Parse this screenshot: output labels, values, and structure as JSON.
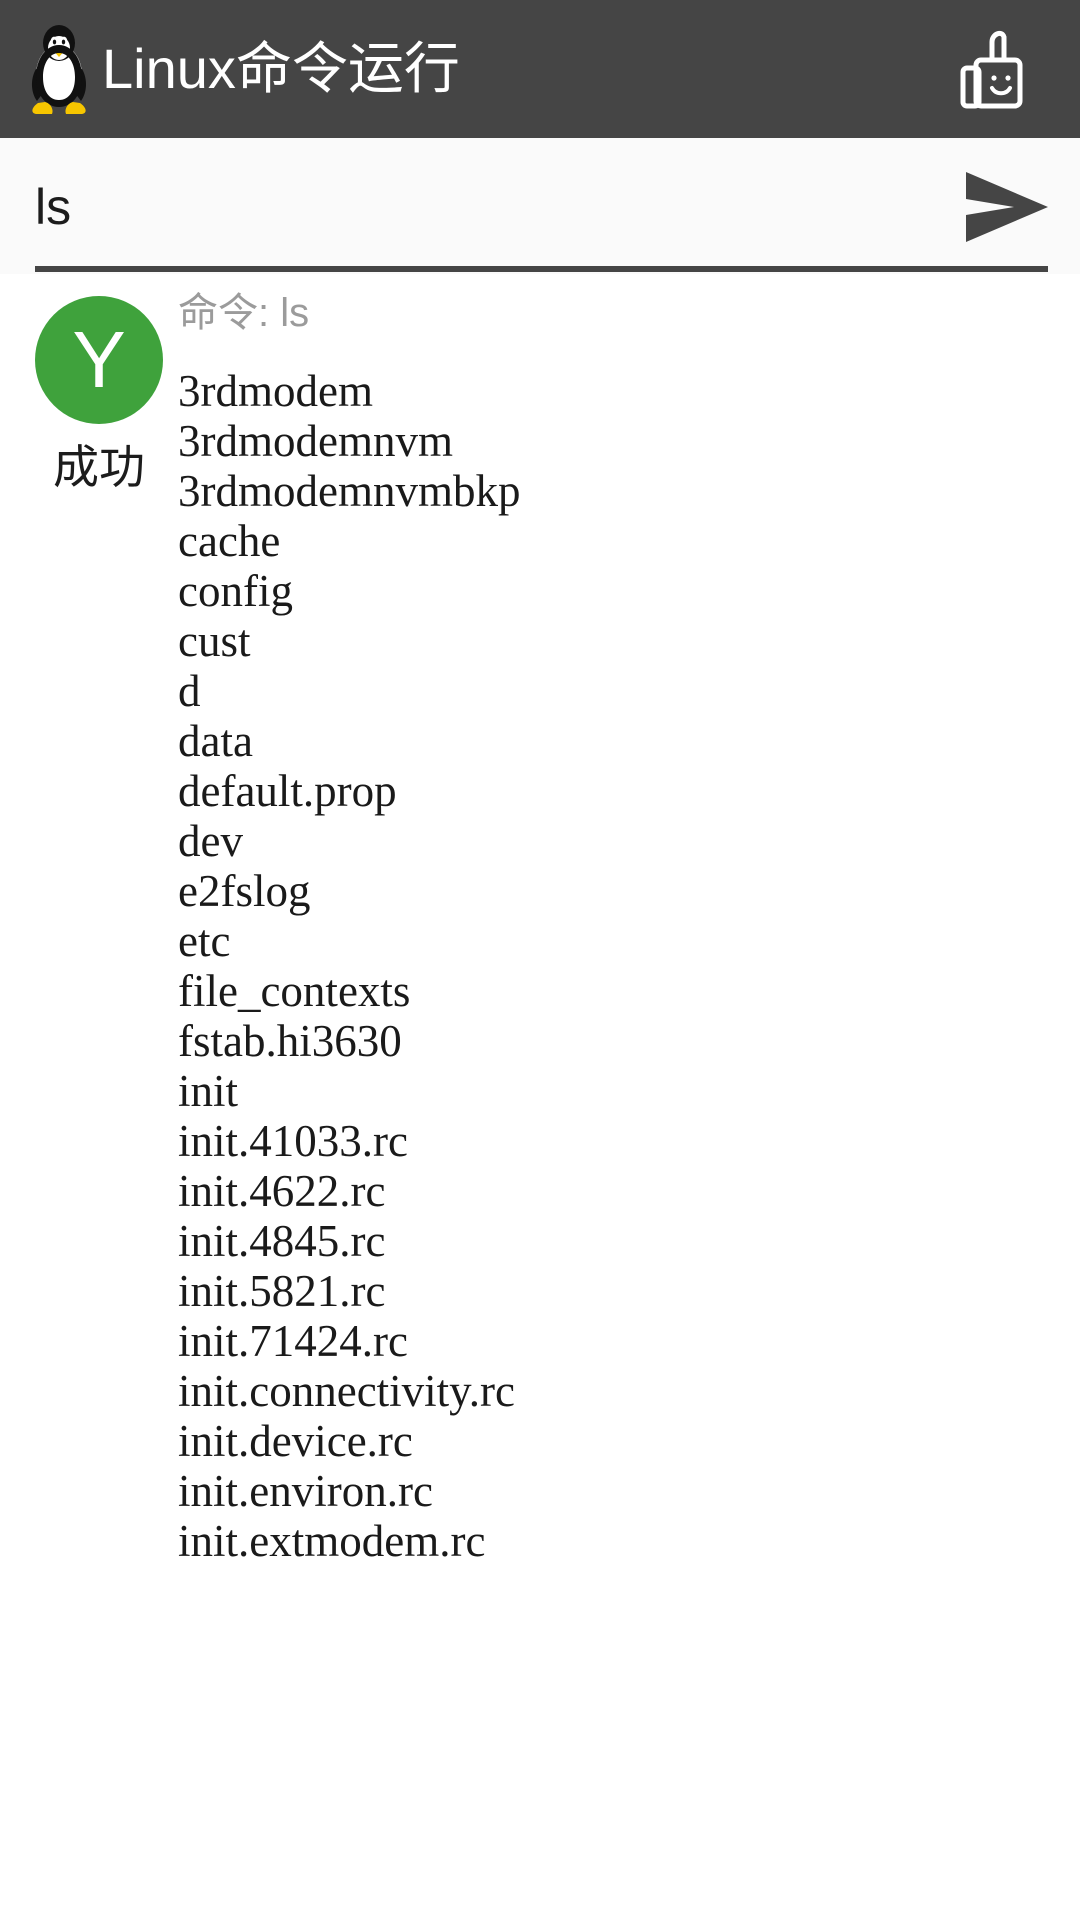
{
  "app_bar": {
    "logo_icon": "tux-penguin-icon",
    "title": "Linux命令运行",
    "action_icon": "thumbs-up-icon",
    "background_color": "#454545",
    "title_color": "#ffffff"
  },
  "input_bar": {
    "value": "ls",
    "placeholder": "",
    "send_icon": "send-paper-plane-icon",
    "underline_color": "#454545",
    "background_color": "#fafafa"
  },
  "result": {
    "status": {
      "avatar_letter": "Y",
      "avatar_color": "#3fa23c",
      "label": "成功"
    },
    "command_echo": "命令: ls",
    "command_echo_color": "#9b9b9b",
    "output_lines": [
      "3rdmodem",
      "3rdmodemnvm",
      "3rdmodemnvmbkp",
      "cache",
      "config",
      "cust",
      "d",
      "data",
      "default.prop",
      "dev",
      "e2fslog",
      "etc",
      "file_contexts",
      "fstab.hi3630",
      "init",
      "init.41033.rc",
      "init.4622.rc",
      "init.4845.rc",
      "init.5821.rc",
      "init.71424.rc",
      "init.connectivity.rc",
      "init.device.rc",
      "init.environ.rc",
      "init.extmodem.rc"
    ]
  }
}
